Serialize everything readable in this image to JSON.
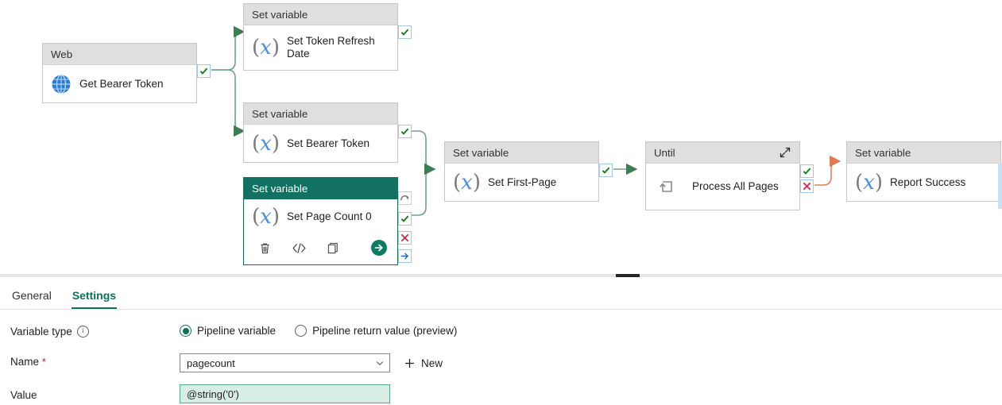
{
  "canvas": {
    "nodes": [
      {
        "id": "web",
        "type_label": "Web",
        "name": "Get Bearer Token",
        "icon": "globe-icon"
      },
      {
        "id": "token-date",
        "type_label": "Set variable",
        "name": "Set Token Refresh Date",
        "icon": "set-variable-icon"
      },
      {
        "id": "bearer-token",
        "type_label": "Set variable",
        "name": "Set Bearer Token",
        "icon": "set-variable-icon"
      },
      {
        "id": "page-count",
        "type_label": "Set variable",
        "name": "Set Page Count 0",
        "icon": "set-variable-icon",
        "selected": true
      },
      {
        "id": "first-page",
        "type_label": "Set variable",
        "name": "Set First-Page",
        "icon": "set-variable-icon"
      },
      {
        "id": "until",
        "type_label": "Until",
        "name": "Process All Pages",
        "icon": "until-loop-icon",
        "expand_icon": "expand-icon"
      },
      {
        "id": "report",
        "type_label": "Set variable",
        "name": "Report Success",
        "icon": "set-variable-icon"
      }
    ],
    "node_toolbar": [
      {
        "name": "delete-icon",
        "glyph": "trash"
      },
      {
        "name": "code-icon",
        "glyph": "code"
      },
      {
        "name": "clone-icon",
        "glyph": "copy"
      },
      {
        "name": "run-icon",
        "glyph": "run"
      }
    ],
    "status_pins": {
      "success": "success-check-icon",
      "failure": "failure-x-icon",
      "completion": "completion-arrow-icon",
      "skipped": "skipped-arrow-icon"
    },
    "colors": {
      "success_wire": "#6fa287",
      "failure_wire": "#e08060",
      "selected_header": "#127160",
      "variable_glyph": "#4a8fe0"
    }
  },
  "pane": {
    "tabs": [
      {
        "id": "general",
        "label": "General",
        "active": false
      },
      {
        "id": "settings",
        "label": "Settings",
        "active": true
      }
    ],
    "fields": {
      "variable_type": {
        "label": "Variable type",
        "info_icon": "info-icon",
        "options": [
          {
            "id": "pipeline-variable",
            "label": "Pipeline variable",
            "selected": true
          },
          {
            "id": "pipeline-return-value",
            "label": "Pipeline return value (preview)",
            "selected": false
          }
        ]
      },
      "name": {
        "label": "Name",
        "required_marker": "*",
        "value": "pagecount",
        "chevron_icon": "chevron-down-icon",
        "new_button": {
          "label": "New",
          "icon": "plus-icon"
        }
      },
      "value": {
        "label": "Value",
        "value": "@string('0')"
      }
    }
  }
}
